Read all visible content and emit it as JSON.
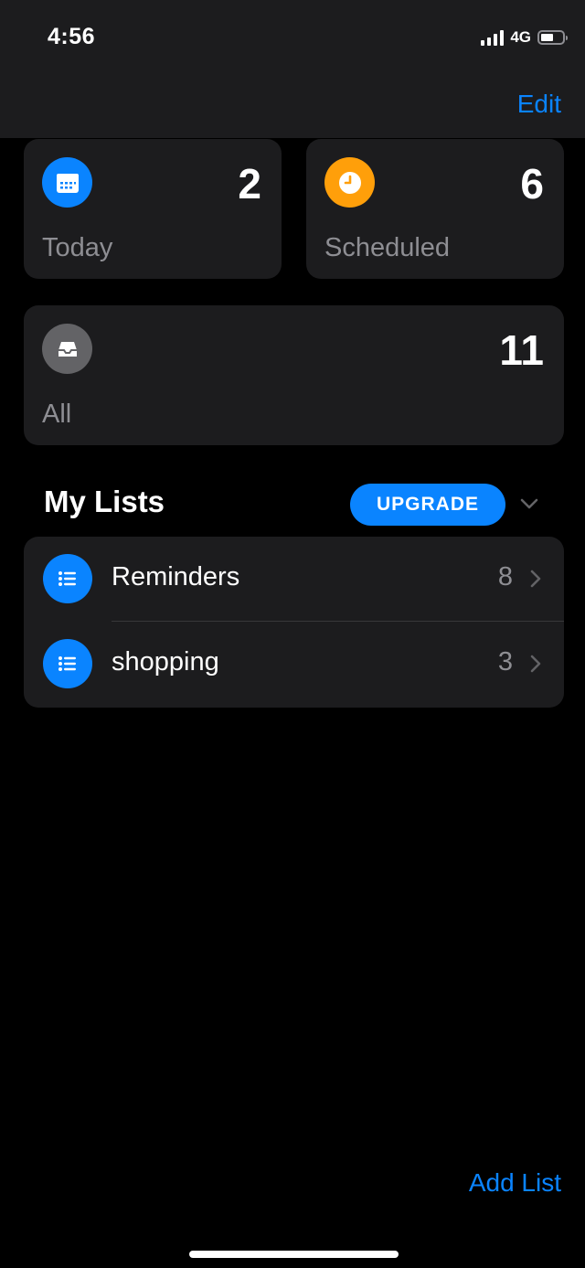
{
  "status_bar": {
    "time": "4:56",
    "network": "4G",
    "signal_bars_filled": 4,
    "battery_level_fraction": 0.6
  },
  "nav": {
    "edit_label": "Edit"
  },
  "smart_lists": {
    "today": {
      "label": "Today",
      "count": "2",
      "icon": "calendar-icon",
      "color": "#0a84ff"
    },
    "scheduled": {
      "label": "Scheduled",
      "count": "6",
      "icon": "clock-icon",
      "color": "#ff9f0a"
    },
    "all": {
      "label": "All",
      "count": "11",
      "icon": "tray-icon",
      "color": "#636366"
    }
  },
  "my_lists": {
    "title": "My Lists",
    "upgrade_label": "UPGRADE",
    "items": [
      {
        "name": "Reminders",
        "count": "8",
        "icon": "list-bullet-icon",
        "color": "#0a84ff"
      },
      {
        "name": "shopping",
        "count": "3",
        "icon": "list-bullet-icon",
        "color": "#0a84ff"
      }
    ]
  },
  "footer": {
    "add_list_label": "Add List"
  },
  "colors": {
    "accent": "#0a84ff",
    "card_background": "#1c1c1e",
    "secondary_text": "#8e8e93"
  }
}
